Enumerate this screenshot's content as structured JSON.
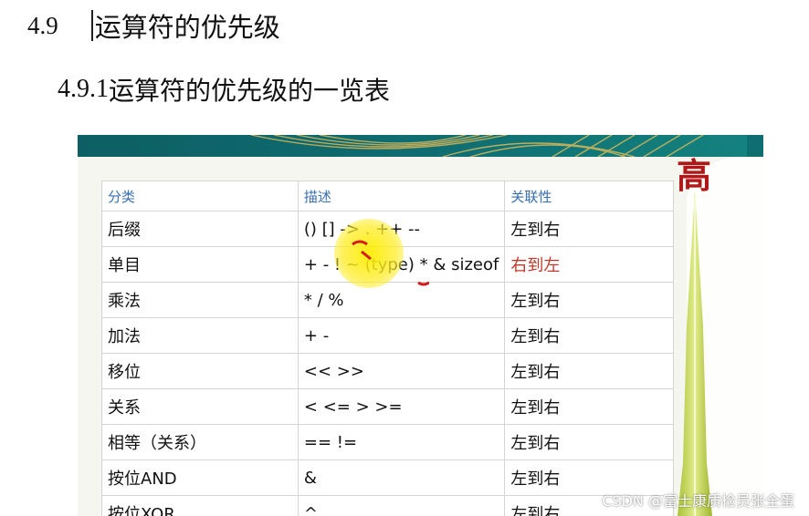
{
  "heading": {
    "number": "4.9",
    "title": "运算符的优先级"
  },
  "subheading": {
    "number": "4.9.1",
    "title": "运算符的优先级的一览表"
  },
  "slide": {
    "high_label": "高",
    "table": {
      "headers": [
        "分类",
        "描述",
        "关联性"
      ],
      "rows": [
        {
          "category": "后缀",
          "operators": "() [] -> . ++ --",
          "assoc": "左到右"
        },
        {
          "category": "单目",
          "operators": "+ - ! ~ (type) * & sizeof",
          "assoc": "右到左"
        },
        {
          "category": "乘法",
          "operators": "* / %",
          "assoc": "左到右"
        },
        {
          "category": "加法",
          "operators": "+ -",
          "assoc": "左到右"
        },
        {
          "category": "移位",
          "operators": "<< >>",
          "assoc": "左到右"
        },
        {
          "category": "关系",
          "operators": "< <= > >=",
          "assoc": "左到右"
        },
        {
          "category": "相等（关系）",
          "operators": "== !=",
          "assoc": "左到右"
        },
        {
          "category": "按位AND",
          "operators": "&",
          "assoc": "左到右"
        },
        {
          "category": "按位XOR",
          "operators": "^",
          "assoc": "左到右"
        }
      ]
    },
    "colors": {
      "banner": "#0f6e72",
      "header_text": "#3a6fb2",
      "red_assoc": "#c0392b",
      "high_label": "#b01818",
      "arrow": "#c6d94a"
    }
  },
  "watermark": "CSDN @富士康质检员张全蛋"
}
